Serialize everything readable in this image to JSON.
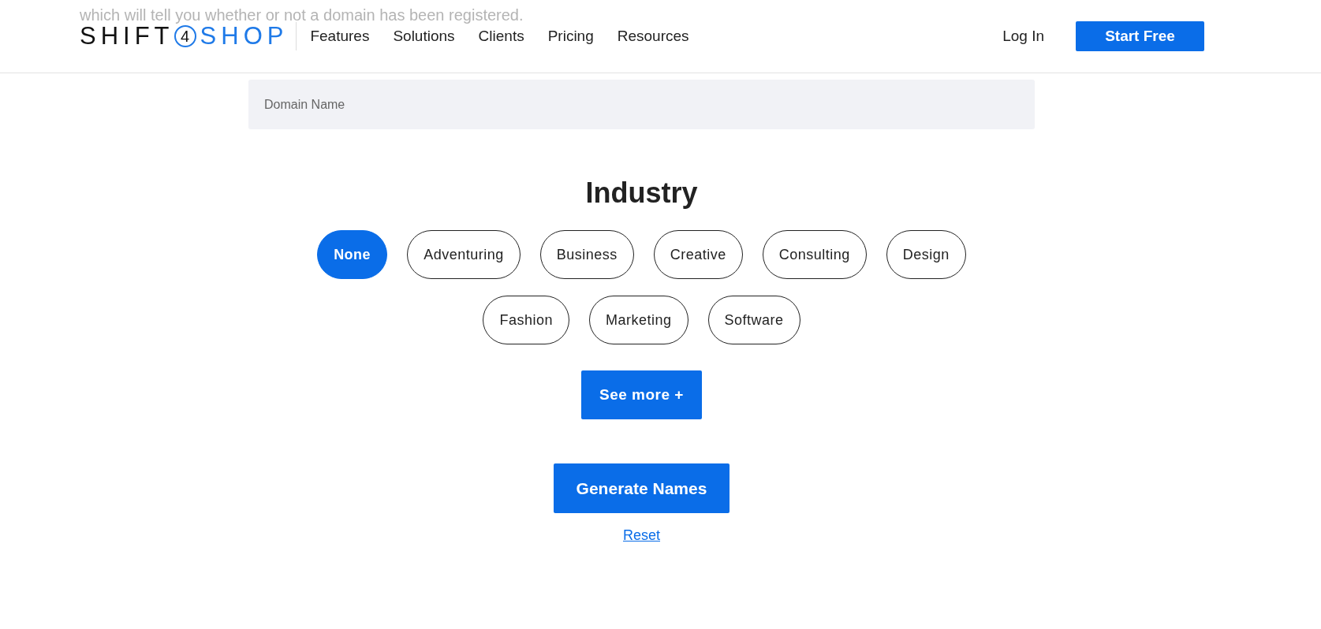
{
  "background_text": "which will tell you whether or not a domain has been registered.",
  "logo": {
    "left": "SHIFT",
    "mark": "4",
    "right": "SHOP"
  },
  "nav": [
    "Features",
    "Solutions",
    "Clients",
    "Pricing",
    "Resources"
  ],
  "login": "Log In",
  "start_button": "Start Free",
  "domain_field": {
    "placeholder": "Domain Name"
  },
  "industry": {
    "title": "Industry",
    "options": [
      {
        "label": "None",
        "selected": true
      },
      {
        "label": "Adventuring",
        "selected": false
      },
      {
        "label": "Business",
        "selected": false
      },
      {
        "label": "Creative",
        "selected": false
      },
      {
        "label": "Consulting",
        "selected": false
      },
      {
        "label": "Design",
        "selected": false
      },
      {
        "label": "Fashion",
        "selected": false
      },
      {
        "label": "Marketing",
        "selected": false
      },
      {
        "label": "Software",
        "selected": false
      }
    ]
  },
  "see_more": "See more +",
  "generate_button": "Generate Names",
  "reset_link": "Reset"
}
